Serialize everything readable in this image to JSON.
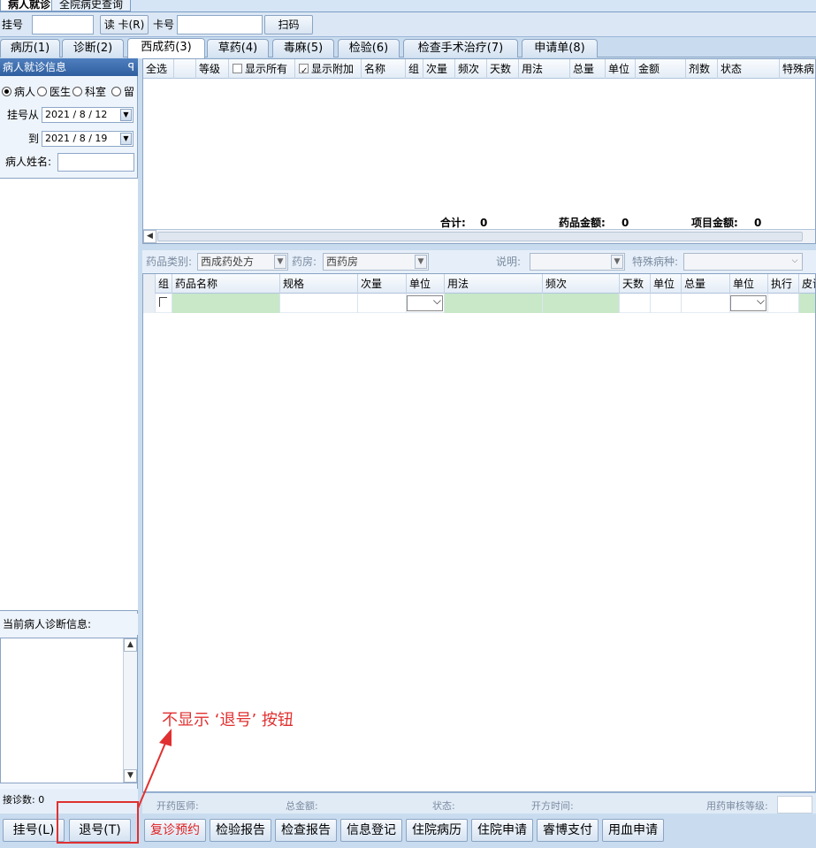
{
  "window_tabs": [
    "病人就诊",
    "全院病史查询"
  ],
  "toolbar": {
    "reg_no_label": "挂号",
    "read_card_button": "读 卡(R)",
    "card_no_label": "卡号",
    "scan_button": "扫码"
  },
  "module_tabs": [
    "病历(1)",
    "诊断(2)",
    "西成药(3)",
    "草药(4)",
    "毒麻(5)",
    "检验(6)",
    "检查手术治疗(7)",
    "申请单(8)"
  ],
  "left_panel": {
    "header": "病人就诊信息",
    "pin_icon": "ꟼ",
    "filters": [
      "病人",
      "医生",
      "科室",
      "留"
    ],
    "reg_from_label": "挂号从",
    "reg_from_date": "2021 / 8 / 12",
    "reg_to_label": "到",
    "reg_to_date": "2021 / 8 / 19",
    "patient_name_label": "病人姓名:",
    "diagnosis_title": "当前病人诊断信息:",
    "visit_count": "接诊数: 0"
  },
  "grid1": {
    "columns": [
      "全选",
      "等级",
      "显示所有",
      "显示附加",
      "名称",
      "组",
      "次量",
      "频次",
      "天数",
      "用法",
      "总量",
      "单位",
      "金额",
      "剂数",
      "状态",
      "特殊病"
    ],
    "total_label": "合计:",
    "total_value": "0",
    "drug_amount_label": "药品金额:",
    "drug_amount_value": "0",
    "item_amount_label": "项目金额:",
    "item_amount_value": "0"
  },
  "filter_row": {
    "drug_category_label": "药品类别:",
    "drug_category_value": "西成药处方",
    "pharmacy_label": "药房:",
    "pharmacy_value": "西药房",
    "note_label": "说明:",
    "special_disease_label": "特殊病种:"
  },
  "grid2": {
    "columns": [
      "组",
      "药品名称",
      "规格",
      "次量",
      "单位",
      "用法",
      "频次",
      "天数",
      "单位",
      "总量",
      "单位",
      "执行",
      "皮试"
    ]
  },
  "status_bar": {
    "doctor_label": "开药医师:",
    "total_label": "总金额:",
    "status_label": "状态:",
    "time_label": "开方时间:",
    "audit_label": "用药审核等级:"
  },
  "bottom_buttons": {
    "register": "挂号(L)",
    "unregister": "退号(T)",
    "actions": [
      "复诊预约",
      "检验报告",
      "检查报告",
      "信息登记",
      "住院病历",
      "住院申请",
      "睿博支付",
      "用血申请"
    ]
  },
  "annotation": {
    "text": "不显示 ‘退号’ 按钮",
    "color": "#e03030"
  }
}
